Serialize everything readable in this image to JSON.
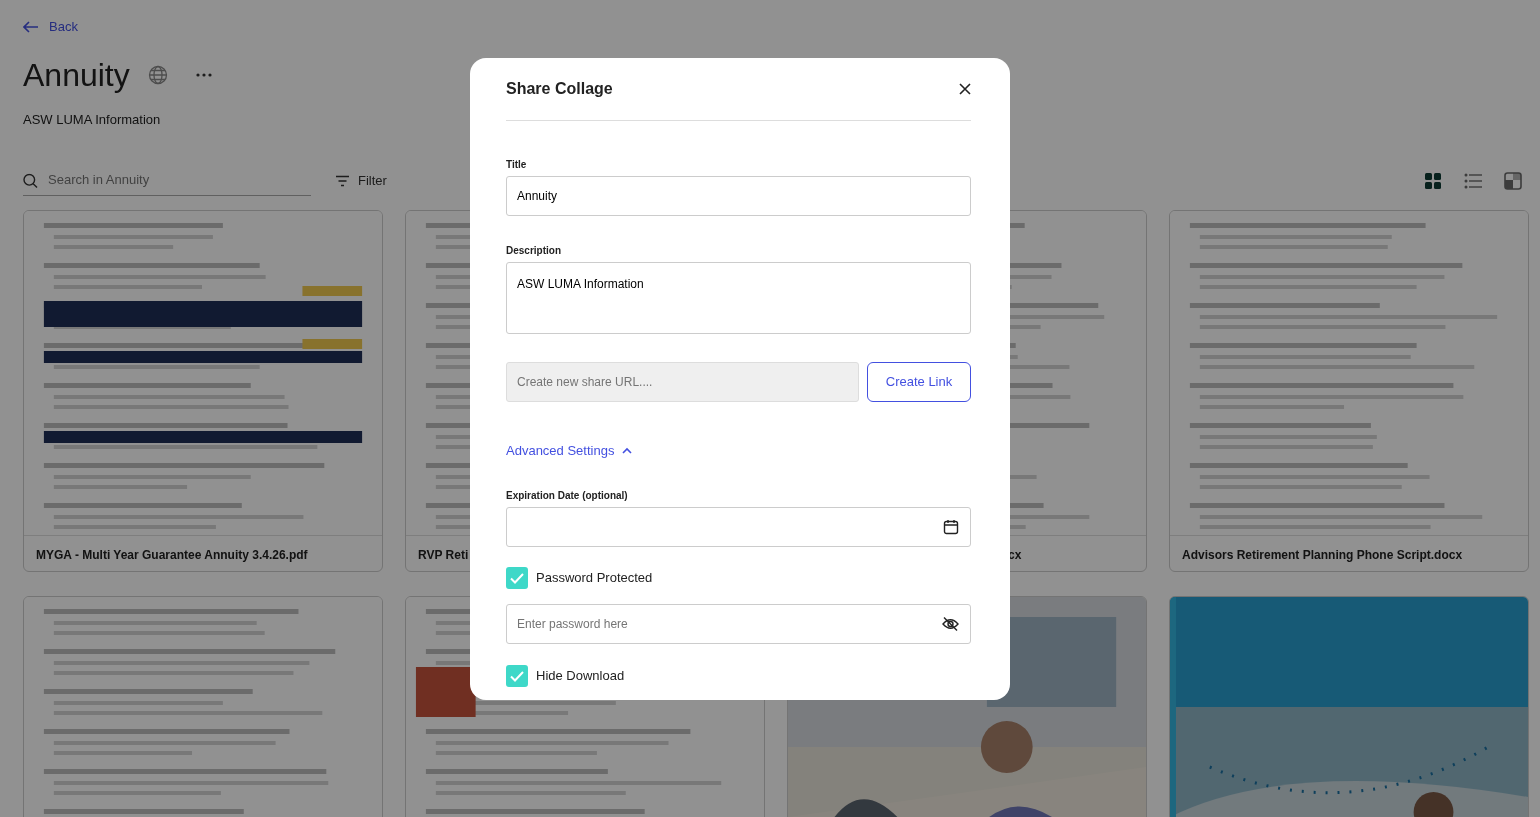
{
  "back": "Back",
  "page": {
    "title": "Annuity",
    "subtitle": "ASW LUMA Information"
  },
  "search": {
    "placeholder": "Search in Annuity"
  },
  "filter": "Filter",
  "views": [
    {
      "kind": "grid",
      "selected": true
    },
    {
      "kind": "list",
      "selected": false
    },
    {
      "kind": "split",
      "selected": false
    }
  ],
  "cards": [
    {
      "title": "MYGA - Multi Year Guarantee Annuity 3.4.26.pdf",
      "kind": "picture"
    },
    {
      "title": "RVP Reti",
      "kind": "picture"
    },
    {
      "title": "cx",
      "kind": "picture"
    },
    {
      "title": "Advisors Retirement Planning Phone Script.docx",
      "kind": "picture"
    },
    {
      "kind": "picture"
    },
    {
      "kind": "picture"
    },
    {
      "kind": "picture"
    },
    {
      "kind": "picture"
    }
  ],
  "modal": {
    "title": "Share Collage",
    "fields": [
      {
        "label": "Title",
        "value": "Annuity",
        "kind": "input"
      },
      {
        "label": "Description",
        "value": "ASW LUMA Information",
        "kind": "textarea"
      }
    ],
    "share_url": {
      "placeholder": "Create new share URL...."
    },
    "create_button": "Create Link",
    "advanced": {
      "label": "Advanced Settings",
      "expanded": true
    },
    "expiration": {
      "label": "Expiration Date (optional)"
    },
    "password_protected": {
      "label": "Password Protected",
      "checked": true
    },
    "password": {
      "placeholder": "Enter password here"
    },
    "hide_download": {
      "label": "Hide Download",
      "checked": true
    }
  }
}
